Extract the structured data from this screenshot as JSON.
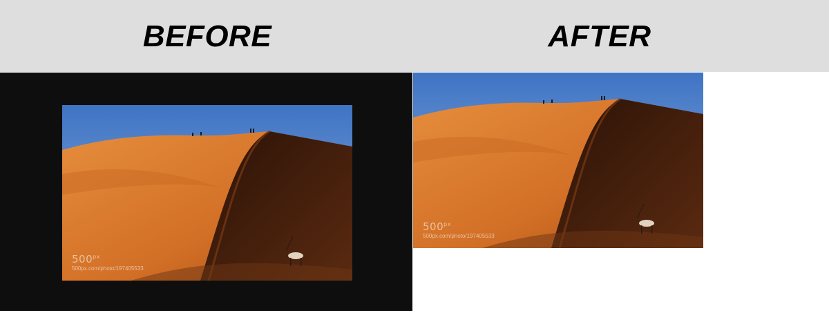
{
  "header": {
    "before_label": "BEFORE",
    "after_label": "AFTER",
    "background_color": "#dedede"
  },
  "before": {
    "panel_color": "#0e0e0e",
    "watermark": {
      "logo": "500",
      "logo_suffix": "px",
      "url": "500px.com/photo/197405533"
    }
  },
  "after": {
    "panel_color": "#ffffff",
    "watermark": {
      "logo": "500",
      "logo_suffix": "px",
      "url": "500px.com/photo/197405533"
    }
  },
  "photo": {
    "subject": "orange sand dune under blue sky with oryx and hikers",
    "sky_color": "#4f7fc6",
    "sand_lit_color": "#d9782e",
    "sand_shadow_color": "#3f1d0c"
  }
}
